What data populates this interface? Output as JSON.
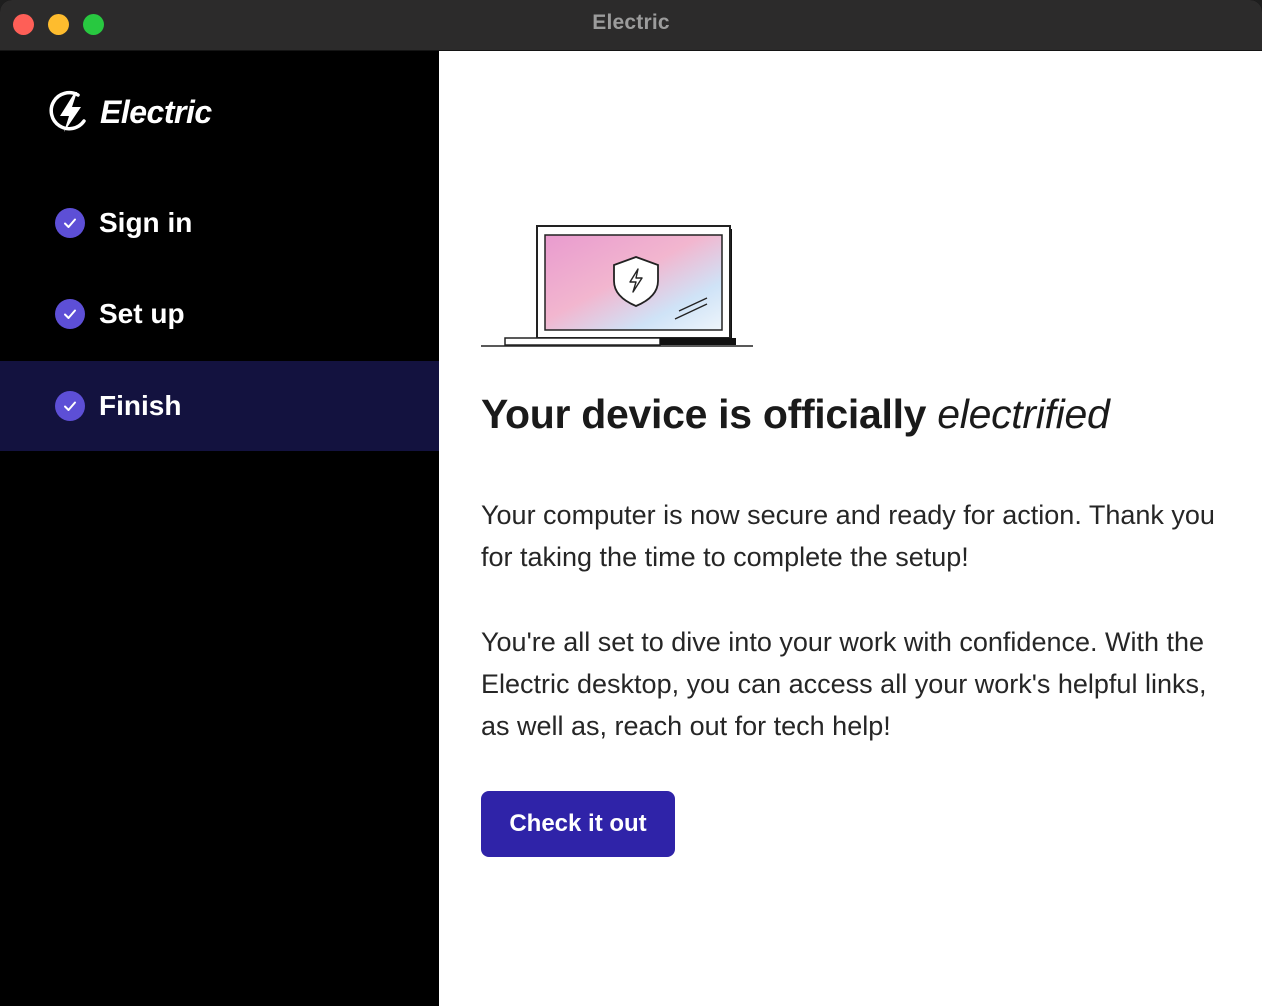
{
  "window": {
    "title": "Electric"
  },
  "brand": {
    "name": "Electric"
  },
  "steps": [
    {
      "label": "Sign in",
      "status": "complete",
      "active": false
    },
    {
      "label": "Set up",
      "status": "complete",
      "active": false
    },
    {
      "label": "Finish",
      "status": "complete",
      "active": true
    }
  ],
  "main": {
    "heading_prefix": "Your device is officially ",
    "heading_emphasis": "electrified",
    "paragraph_1": "Your computer is now secure and ready for action. Thank you for taking the time to complete the setup!",
    "paragraph_2": "You're all set to dive into your work with confidence. With the Electric desktop, you can access all your work's helpful links, as well as, reach out for tech help!",
    "cta_label": "Check it out"
  },
  "colors": {
    "sidebar_bg": "#000000",
    "active_step_bg": "#13123f",
    "check_badge": "#5d4fd6",
    "cta_bg": "#2f23a8"
  },
  "icons": [
    "lightning-logo-icon",
    "check-icon",
    "laptop-shield-illustration"
  ]
}
